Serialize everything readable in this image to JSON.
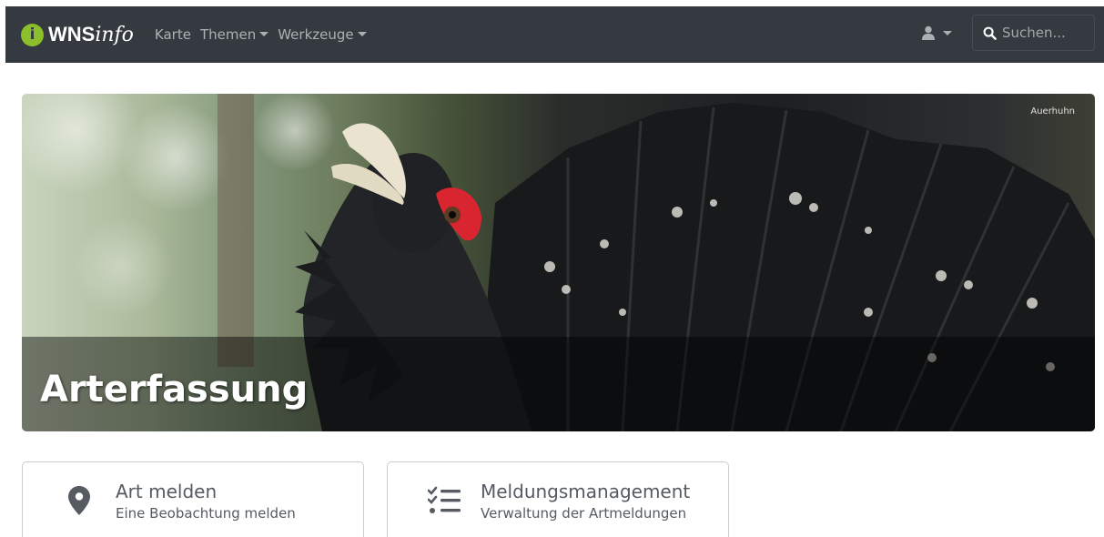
{
  "brand": {
    "badge": "i",
    "name_bold": "WNS",
    "name_italic": "info"
  },
  "nav": {
    "items": [
      {
        "label": "Karte"
      },
      {
        "label": "Themen"
      },
      {
        "label": "Werkzeuge"
      }
    ]
  },
  "search": {
    "placeholder": "Suchen..."
  },
  "hero": {
    "title": "Arterfassung",
    "credit": "Auerhuhn"
  },
  "cards": [
    {
      "title": "Art melden",
      "subtitle": "Eine Beobachtung melden",
      "icon": "map-marker-icon"
    },
    {
      "title": "Meldungsmanagement",
      "subtitle": "Verwaltung der Artmeldungen",
      "icon": "tasks-icon"
    }
  ],
  "colors": {
    "navbar": "#343a40",
    "brand_green": "#8bbf2c",
    "card_text": "#555b61"
  }
}
